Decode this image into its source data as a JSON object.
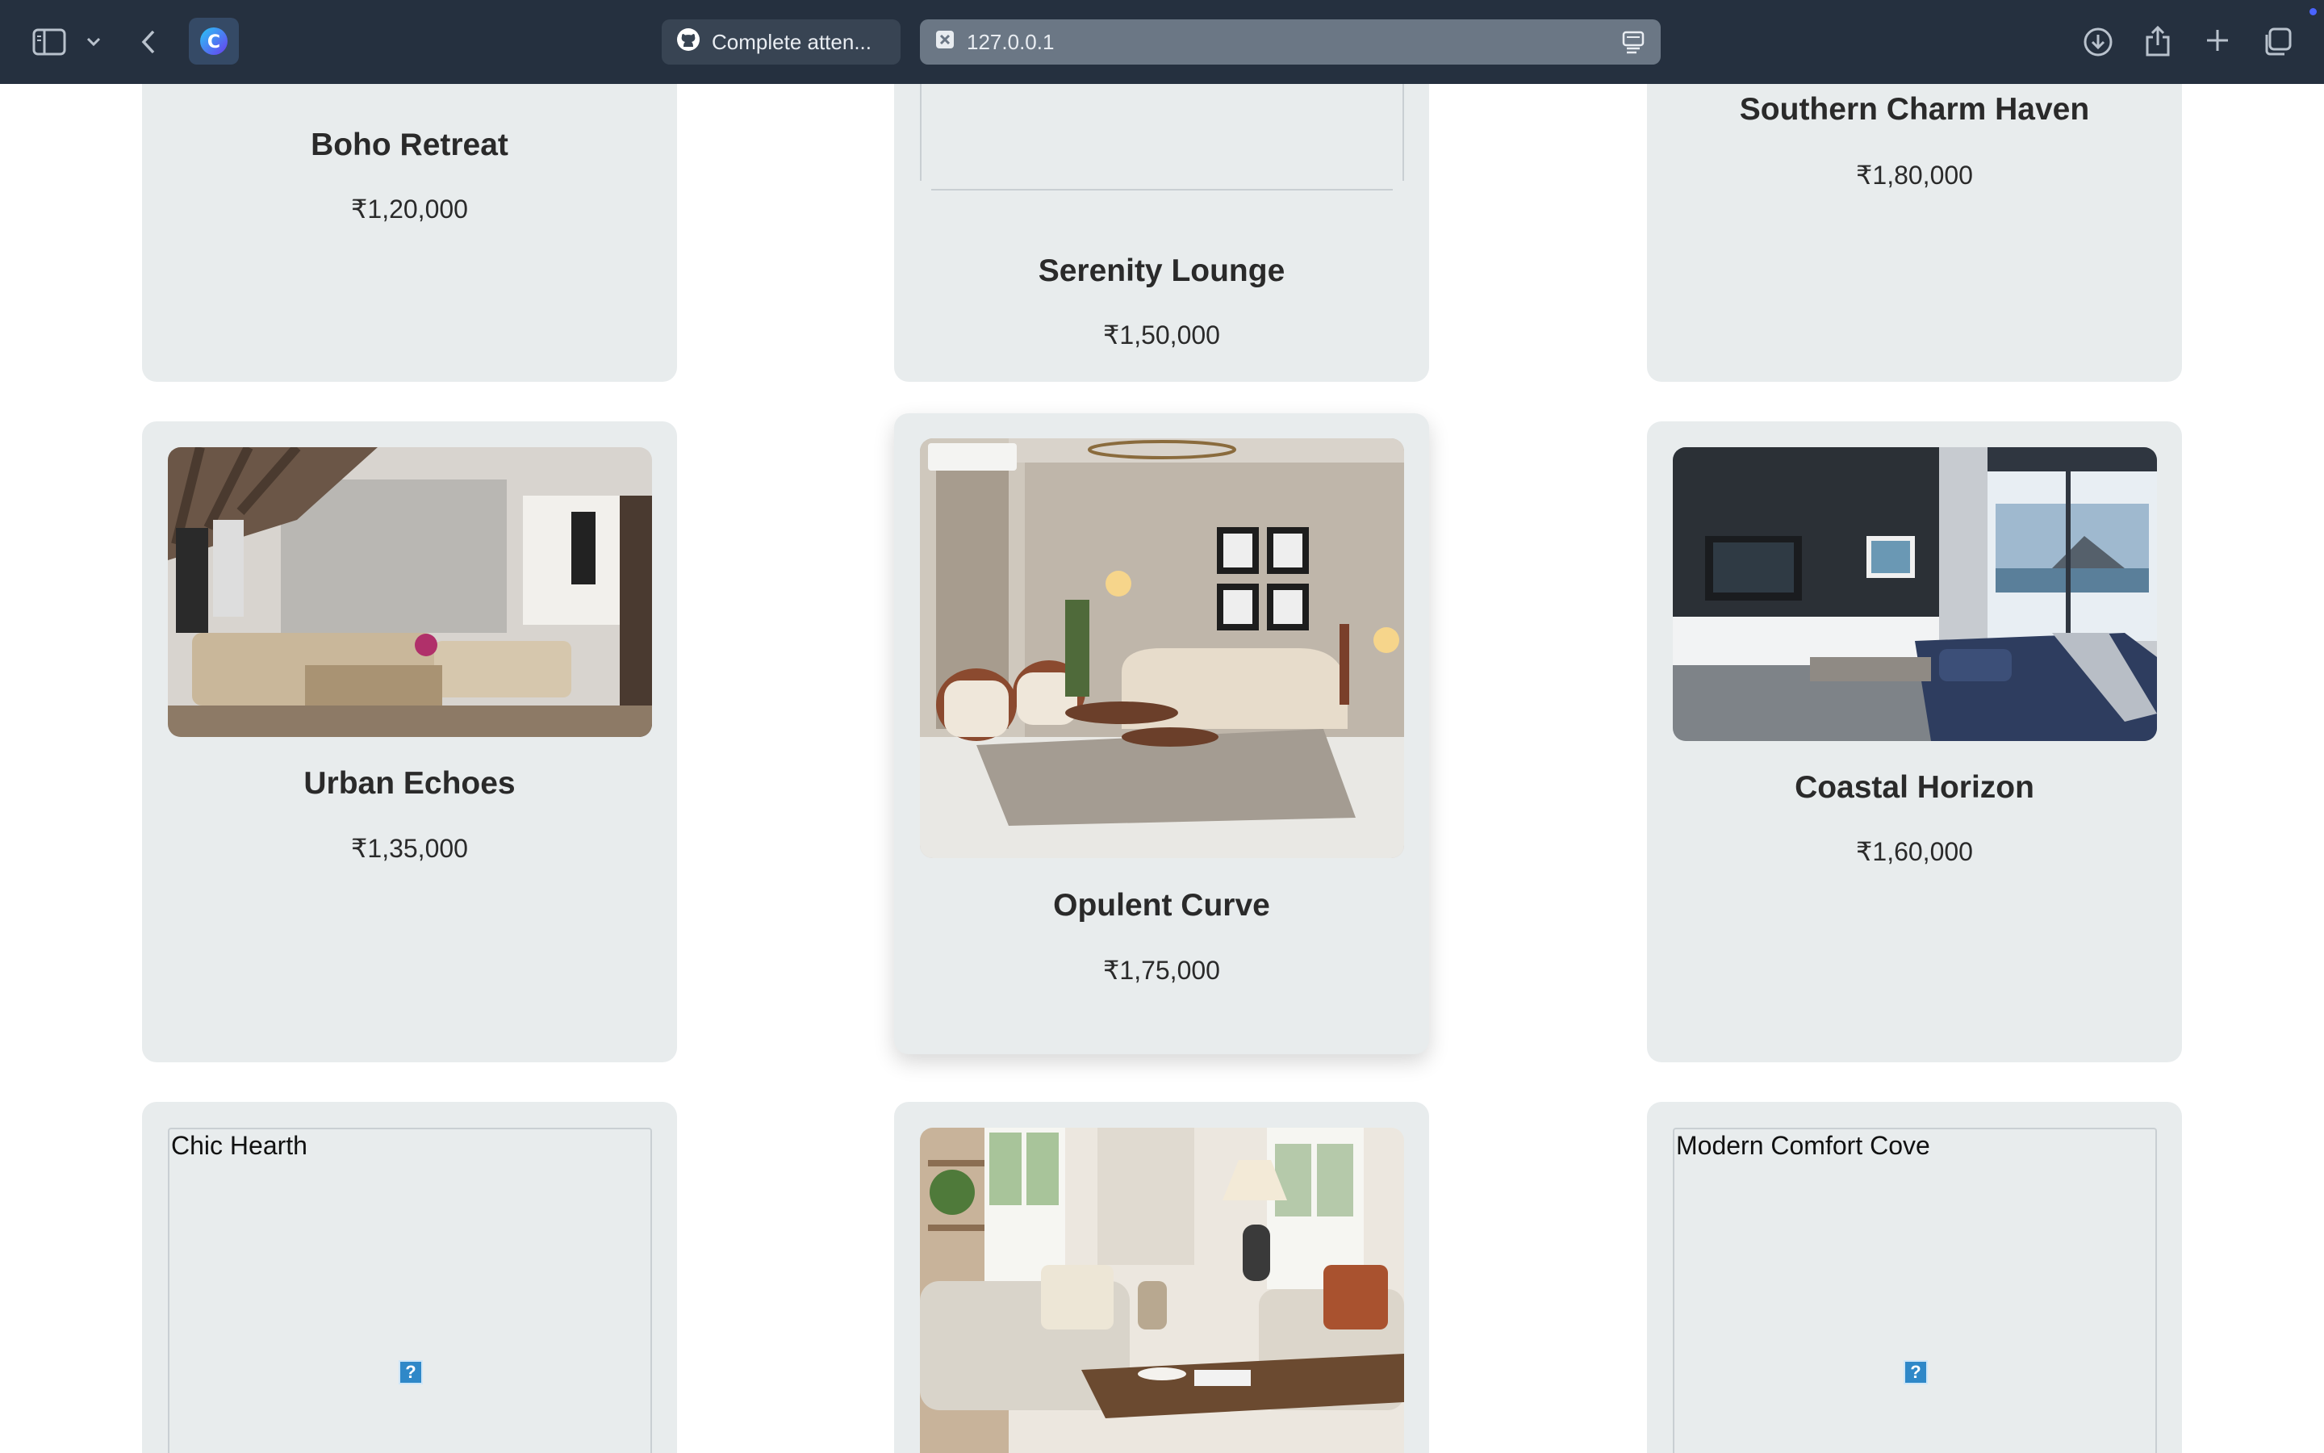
{
  "browser": {
    "tabs": [
      {
        "icon": "github-icon",
        "label": "Complete atten..."
      },
      {
        "icon": "close-tab-icon",
        "label": "127.0.0.1"
      }
    ],
    "accent_color": "#4a63ff"
  },
  "gallery": {
    "cards": [
      {
        "title": "Boho Retreat",
        "price": "₹1,20,000"
      },
      {
        "title": "Serenity Lounge",
        "price": "₹1,50,000"
      },
      {
        "title": "Southern Charm Haven",
        "price": "₹1,80,000"
      },
      {
        "title": "Urban Echoes",
        "price": "₹1,35,000"
      },
      {
        "title": "Opulent Curve",
        "price": "₹1,75,000"
      },
      {
        "title": "Coastal Horizon",
        "price": "₹1,60,000"
      },
      {
        "title": "Chic Hearth",
        "price": ""
      },
      {
        "title": "",
        "price": ""
      },
      {
        "title": "Modern Comfort Cove",
        "price": ""
      }
    ],
    "broken_images": [
      {
        "alt": "Chic Hearth",
        "icon": "broken-image-icon"
      },
      {
        "alt": "Modern Comfort Cove",
        "icon": "broken-image-icon"
      }
    ],
    "colors": {
      "card": "#e8eced",
      "text": "#2a2a2a"
    }
  }
}
